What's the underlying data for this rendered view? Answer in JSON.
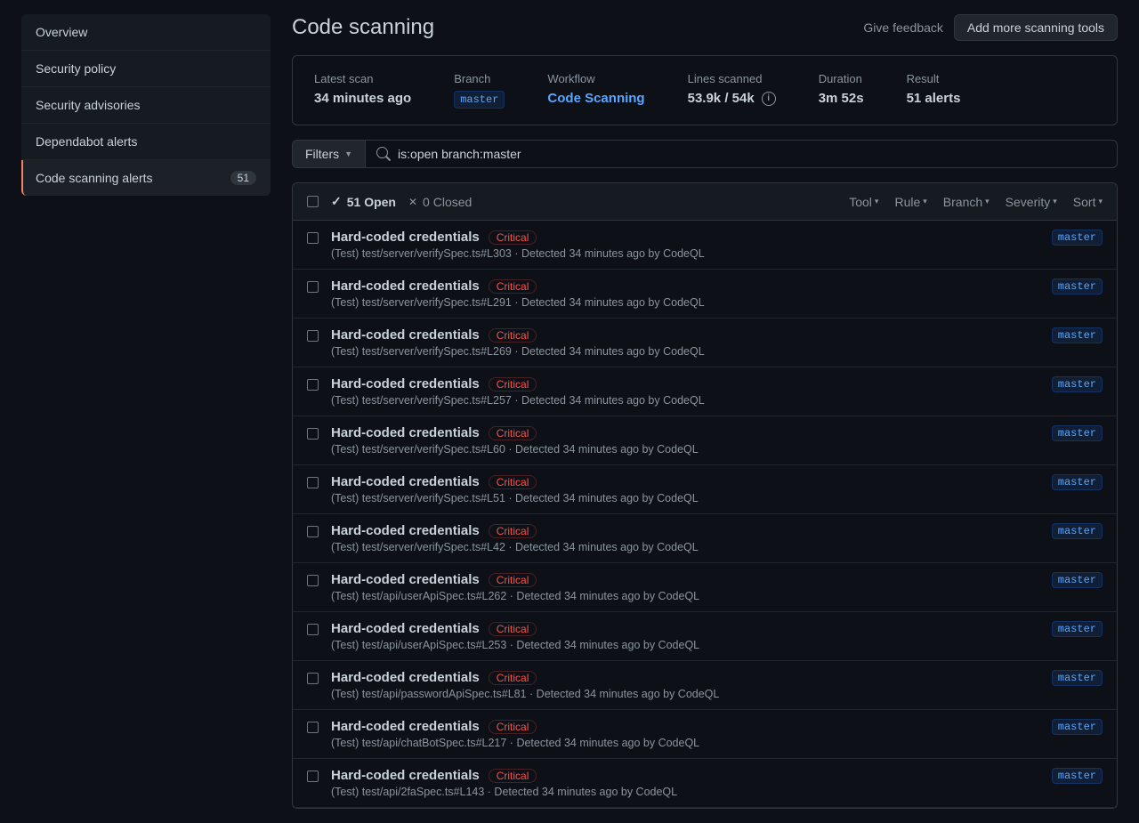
{
  "sidebar": {
    "items": [
      {
        "label": "Overview"
      },
      {
        "label": "Security policy"
      },
      {
        "label": "Security advisories"
      },
      {
        "label": "Dependabot alerts"
      },
      {
        "label": "Code scanning alerts",
        "count": "51",
        "active": true
      }
    ]
  },
  "header": {
    "title": "Code scanning",
    "feedback": "Give feedback",
    "add_tools": "Add more scanning tools"
  },
  "summary": {
    "latest_scan_label": "Latest scan",
    "latest_scan_value": "34 minutes ago",
    "branch_label": "Branch",
    "branch_value": "master",
    "workflow_label": "Workflow",
    "workflow_value": "Code Scanning",
    "lines_label": "Lines scanned",
    "lines_value": "53.9k / 54k",
    "duration_label": "Duration",
    "duration_value": "3m 52s",
    "result_label": "Result",
    "result_value": "51 alerts"
  },
  "filters": {
    "button": "Filters",
    "query": "is:open branch:master"
  },
  "list_header": {
    "open": "51 Open",
    "closed": "0 Closed",
    "dropdowns": [
      "Tool",
      "Rule",
      "Branch",
      "Severity",
      "Sort"
    ]
  },
  "alerts": [
    {
      "title": "Hard-coded credentials",
      "severity": "Critical",
      "meta": "(Test) test/server/verifySpec.ts#L303 · Detected 34 minutes ago by CodeQL",
      "branch": "master"
    },
    {
      "title": "Hard-coded credentials",
      "severity": "Critical",
      "meta": "(Test) test/server/verifySpec.ts#L291 · Detected 34 minutes ago by CodeQL",
      "branch": "master"
    },
    {
      "title": "Hard-coded credentials",
      "severity": "Critical",
      "meta": "(Test) test/server/verifySpec.ts#L269 · Detected 34 minutes ago by CodeQL",
      "branch": "master"
    },
    {
      "title": "Hard-coded credentials",
      "severity": "Critical",
      "meta": "(Test) test/server/verifySpec.ts#L257 · Detected 34 minutes ago by CodeQL",
      "branch": "master"
    },
    {
      "title": "Hard-coded credentials",
      "severity": "Critical",
      "meta": "(Test) test/server/verifySpec.ts#L60 · Detected 34 minutes ago by CodeQL",
      "branch": "master"
    },
    {
      "title": "Hard-coded credentials",
      "severity": "Critical",
      "meta": "(Test) test/server/verifySpec.ts#L51 · Detected 34 minutes ago by CodeQL",
      "branch": "master"
    },
    {
      "title": "Hard-coded credentials",
      "severity": "Critical",
      "meta": "(Test) test/server/verifySpec.ts#L42 · Detected 34 minutes ago by CodeQL",
      "branch": "master"
    },
    {
      "title": "Hard-coded credentials",
      "severity": "Critical",
      "meta": "(Test) test/api/userApiSpec.ts#L262 · Detected 34 minutes ago by CodeQL",
      "branch": "master"
    },
    {
      "title": "Hard-coded credentials",
      "severity": "Critical",
      "meta": "(Test) test/api/userApiSpec.ts#L253 · Detected 34 minutes ago by CodeQL",
      "branch": "master"
    },
    {
      "title": "Hard-coded credentials",
      "severity": "Critical",
      "meta": "(Test) test/api/passwordApiSpec.ts#L81 · Detected 34 minutes ago by CodeQL",
      "branch": "master"
    },
    {
      "title": "Hard-coded credentials",
      "severity": "Critical",
      "meta": "(Test) test/api/chatBotSpec.ts#L217 · Detected 34 minutes ago by CodeQL",
      "branch": "master"
    },
    {
      "title": "Hard-coded credentials",
      "severity": "Critical",
      "meta": "(Test) test/api/2faSpec.ts#L143 · Detected 34 minutes ago by CodeQL",
      "branch": "master"
    }
  ]
}
